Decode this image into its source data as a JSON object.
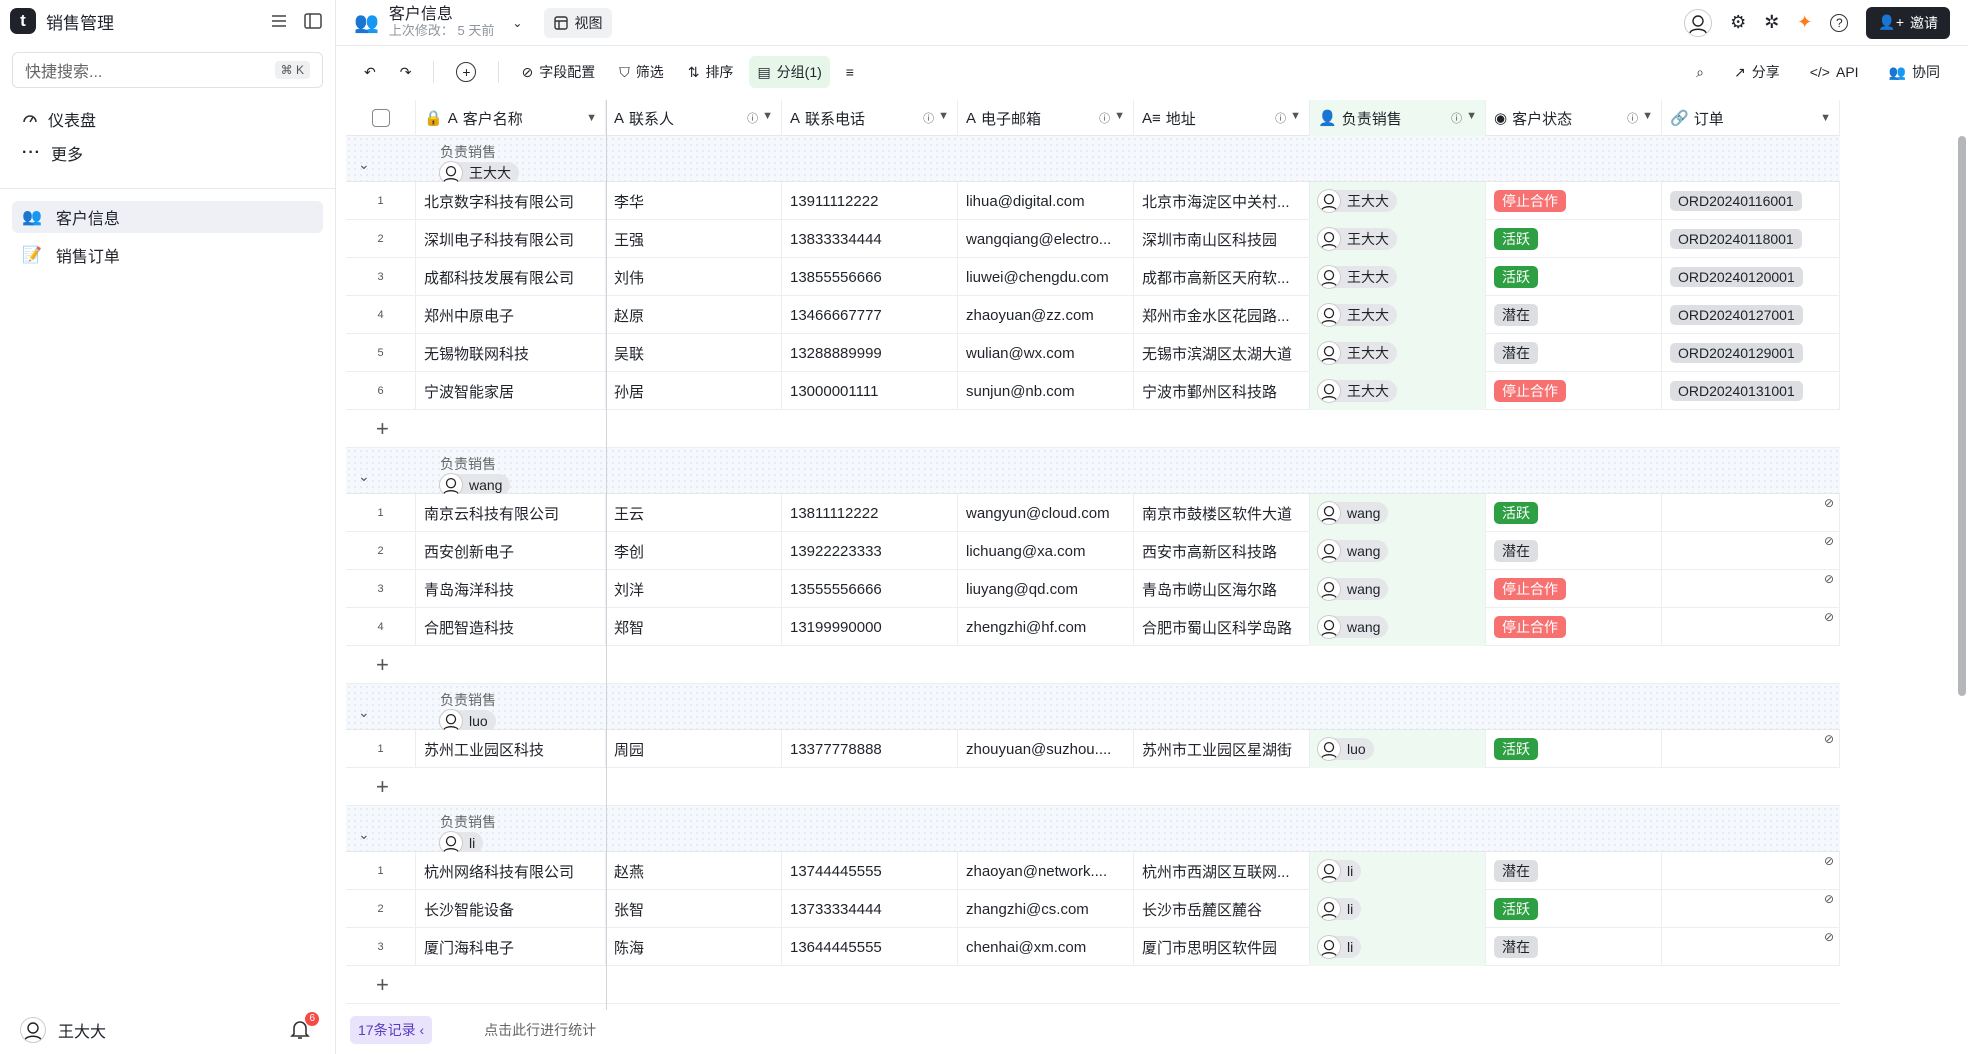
{
  "sidebar": {
    "title": "销售管理",
    "search_placeholder": "快捷搜索...",
    "shortcut": "⌘ K",
    "nav": [
      {
        "label": "仪表盘",
        "icon": "gauge-icon"
      },
      {
        "label": "更多",
        "icon": "more-icon"
      }
    ],
    "tables": [
      {
        "label": "客户信息",
        "icon": "people-icon",
        "active": true
      },
      {
        "label": "销售订单",
        "icon": "memo-icon",
        "active": false
      }
    ],
    "user": "王大大",
    "notif_count": "6"
  },
  "topbar": {
    "title": "客户信息",
    "last_modified_label": "上次修改：",
    "last_modified": "5 天前",
    "view_label": "视图",
    "invite_label": "邀请"
  },
  "toolbar": {
    "field_config": "字段配置",
    "filter": "筛选",
    "sort": "排序",
    "group": "分组(1)",
    "share": "分享",
    "api": "API",
    "collab": "协同"
  },
  "columns": [
    "客户名称",
    "联系人",
    "联系电话",
    "电子邮箱",
    "地址",
    "负责销售",
    "客户状态",
    "订单"
  ],
  "group_label": "负责销售",
  "groups": [
    {
      "owner": "王大大",
      "rows": [
        [
          "1",
          "北京数字科技有限公司",
          "李华",
          "13911112222",
          "lihua@digital.com",
          "北京市海淀区中关村...",
          "王大大",
          "停止合作",
          "ORD20240116001"
        ],
        [
          "2",
          "深圳电子科技有限公司",
          "王强",
          "13833334444",
          "wangqiang@electro...",
          "深圳市南山区科技园",
          "王大大",
          "活跃",
          "ORD20240118001"
        ],
        [
          "3",
          "成都科技发展有限公司",
          "刘伟",
          "13855556666",
          "liuwei@chengdu.com",
          "成都市高新区天府软...",
          "王大大",
          "活跃",
          "ORD20240120001"
        ],
        [
          "4",
          "郑州中原电子",
          "赵原",
          "13466667777",
          "zhaoyuan@zz.com",
          "郑州市金水区花园路...",
          "王大大",
          "潜在",
          "ORD20240127001"
        ],
        [
          "5",
          "无锡物联网科技",
          "吴联",
          "13288889999",
          "wulian@wx.com",
          "无锡市滨湖区太湖大道",
          "王大大",
          "潜在",
          "ORD20240129001"
        ],
        [
          "6",
          "宁波智能家居",
          "孙居",
          "13000001111",
          "sunjun@nb.com",
          "宁波市鄞州区科技路",
          "王大大",
          "停止合作",
          "ORD20240131001"
        ]
      ]
    },
    {
      "owner": "wang",
      "rows": [
        [
          "1",
          "南京云科技有限公司",
          "王云",
          "13811112222",
          "wangyun@cloud.com",
          "南京市鼓楼区软件大道",
          "wang",
          "活跃",
          ""
        ],
        [
          "2",
          "西安创新电子",
          "李创",
          "13922223333",
          "lichuang@xa.com",
          "西安市高新区科技路",
          "wang",
          "潜在",
          ""
        ],
        [
          "3",
          "青岛海洋科技",
          "刘洋",
          "13555556666",
          "liuyang@qd.com",
          "青岛市崂山区海尔路",
          "wang",
          "停止合作",
          ""
        ],
        [
          "4",
          "合肥智造科技",
          "郑智",
          "13199990000",
          "zhengzhi@hf.com",
          "合肥市蜀山区科学岛路",
          "wang",
          "停止合作",
          ""
        ]
      ]
    },
    {
      "owner": "luo",
      "rows": [
        [
          "1",
          "苏州工业园区科技",
          "周园",
          "13377778888",
          "zhouyuan@suzhou....",
          "苏州市工业园区星湖街",
          "luo",
          "活跃",
          ""
        ]
      ]
    },
    {
      "owner": "li",
      "rows": [
        [
          "1",
          "杭州网络科技有限公司",
          "赵燕",
          "13744445555",
          "zhaoyan@network....",
          "杭州市西湖区互联网...",
          "li",
          "潜在",
          ""
        ],
        [
          "2",
          "长沙智能设备",
          "张智",
          "13733334444",
          "zhangzhi@cs.com",
          "长沙市岳麓区麓谷",
          "li",
          "活跃",
          ""
        ],
        [
          "3",
          "厦门海科电子",
          "陈海",
          "13644445555",
          "chenhai@xm.com",
          "厦门市思明区软件园",
          "li",
          "潜在",
          ""
        ]
      ]
    }
  ],
  "footer": {
    "records": "17条记录",
    "stat_hint": "点击此行进行统计"
  },
  "colors": {
    "stop": "#f87171",
    "active": "#2ea043",
    "potential": "#dcdee1",
    "group_accent": "#e6f7ea"
  }
}
